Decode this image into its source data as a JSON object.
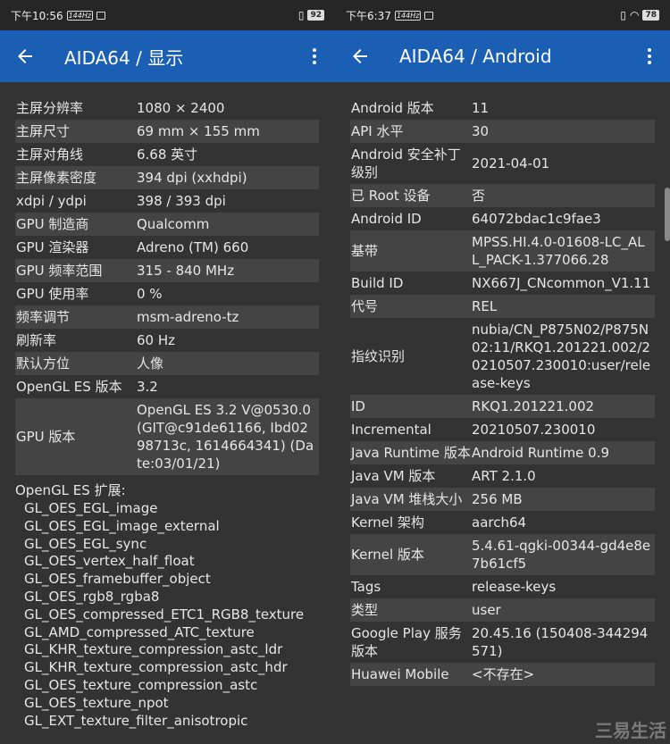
{
  "left": {
    "status": {
      "time": "下午10:56",
      "hz": "144Hz",
      "battery": "92"
    },
    "title": "AIDA64  /  显示",
    "rows": [
      {
        "k": "主屏分辨率",
        "v": "1080 × 2400"
      },
      {
        "k": "主屏尺寸",
        "v": "69 mm × 155 mm"
      },
      {
        "k": "主屏对角线",
        "v": "6.68 英寸"
      },
      {
        "k": "主屏像素密度",
        "v": "394 dpi (xxhdpi)"
      },
      {
        "k": "xdpi / ydpi",
        "v": "398 / 393 dpi"
      },
      {
        "k": "GPU 制造商",
        "v": "Qualcomm"
      },
      {
        "k": "GPU 渲染器",
        "v": "Adreno (TM) 660"
      },
      {
        "k": "GPU 频率范围",
        "v": "315 - 840 MHz"
      },
      {
        "k": "GPU 使用率",
        "v": "0 %"
      },
      {
        "k": "频率调节",
        "v": "msm-adreno-tz"
      },
      {
        "k": "刷新率",
        "v": "60 Hz"
      },
      {
        "k": "默认方位",
        "v": "人像"
      },
      {
        "k": "OpenGL ES 版本",
        "v": "3.2"
      },
      {
        "k": "GPU 版本",
        "v": "OpenGL ES 3.2 V@0530.0 (GIT@c91de61166, Ibd0298713c, 1614664341) (Date:03/01/21)"
      }
    ],
    "ext_title": "OpenGL ES 扩展:",
    "extensions": [
      "GL_OES_EGL_image",
      "GL_OES_EGL_image_external",
      "GL_OES_EGL_sync",
      "GL_OES_vertex_half_float",
      "GL_OES_framebuffer_object",
      "GL_OES_rgb8_rgba8",
      "GL_OES_compressed_ETC1_RGB8_texture",
      "GL_AMD_compressed_ATC_texture",
      "GL_KHR_texture_compression_astc_ldr",
      "GL_KHR_texture_compression_astc_hdr",
      "GL_OES_texture_compression_astc",
      "GL_OES_texture_npot",
      "GL_EXT_texture_filter_anisotropic"
    ]
  },
  "right": {
    "status": {
      "time": "下午6:37",
      "hz": "144Hz",
      "battery": "78"
    },
    "title": "AIDA64  /  Android",
    "rows": [
      {
        "k": "Android 版本",
        "v": "11"
      },
      {
        "k": "API 水平",
        "v": "30"
      },
      {
        "k": "Android 安全补丁级别",
        "v": "2021-04-01"
      },
      {
        "k": "已 Root 设备",
        "v": "否"
      },
      {
        "k": "Android ID",
        "v": "64072bdac1c9fae3"
      },
      {
        "k": "基带",
        "v": "MPSS.HI.4.0-01608-LC_ALL_PACK-1.377066.28"
      },
      {
        "k": "Build ID",
        "v": "NX667J_CNcommon_V1.11"
      },
      {
        "k": "代号",
        "v": "REL"
      },
      {
        "k": "指纹识别",
        "v": "nubia/CN_P875N02/P875N02:11/RKQ1.201221.002/20210507.230010:user/release-keys"
      },
      {
        "k": "ID",
        "v": "RKQ1.201221.002"
      },
      {
        "k": "Incremental",
        "v": "20210507.230010"
      },
      {
        "k": "Java Runtime 版本",
        "v": "Android Runtime 0.9"
      },
      {
        "k": "Java VM 版本",
        "v": "ART 2.1.0"
      },
      {
        "k": "Java VM 堆栈大小",
        "v": "256 MB"
      },
      {
        "k": "Kernel 架构",
        "v": "aarch64"
      },
      {
        "k": "Kernel 版本",
        "v": "5.4.61-qgki-00344-gd4e8e7b61cf5"
      },
      {
        "k": "Tags",
        "v": "release-keys"
      },
      {
        "k": "类型",
        "v": "user"
      },
      {
        "k": "Google Play 服务版本",
        "v": "20.45.16 (150408-344294571)"
      },
      {
        "k": "Huawei Mobile",
        "v": "<不存在>"
      }
    ]
  },
  "watermark": "三易生活"
}
